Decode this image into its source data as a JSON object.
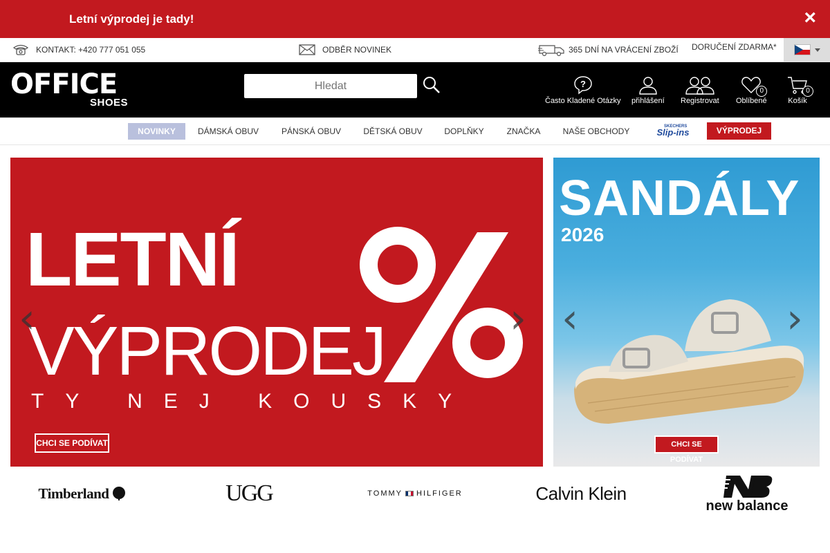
{
  "promo": {
    "text": " Letní výprodej je tady! ",
    "close": "×"
  },
  "infobar": {
    "contact": "KONTAKT: +420 777 051 055",
    "newsletter": "ODBĚR NOVINEK",
    "returns": "365 DNÍ NA VRÁCENÍ ZBOŽÍ",
    "delivery": "DORUČENÍ ZDARMA*",
    "language": "cz"
  },
  "header": {
    "logo_main": "OFFICE",
    "logo_sub": "SHOES",
    "search_placeholder": "Hledat",
    "faq_label": "Často Kladené Otázky",
    "login_label": "přihlášení",
    "register_label": "Registrovat",
    "favorites_label": "Oblíbené",
    "favorites_count": "0",
    "cart_label": "Košík",
    "cart_count": "0"
  },
  "nav": {
    "items": [
      {
        "label": "NOVINKY"
      },
      {
        "label": "DÁMSKÁ OBUV"
      },
      {
        "label": "PÁNSKÁ OBUV"
      },
      {
        "label": "DĚTSKÁ OBUV"
      },
      {
        "label": "DOPLŇKY"
      },
      {
        "label": "ZNAČKA"
      },
      {
        "label": "NAŠE OBCHODY"
      },
      {
        "label": "VÝPRODEJ"
      }
    ],
    "slipins_top": "SKECHERS",
    "slipins_label": "Slip-ins"
  },
  "banner_main": {
    "line1": "LETNÍ",
    "line2": "VÝPRODEJ",
    "tagline": "TY NEJ KOUSKY",
    "cta": "CHCI SE PODÍVAT",
    "prev": "‹",
    "next": "›"
  },
  "banner_side": {
    "title": "SANDÁLY",
    "year": "2026",
    "cta": "CHCI SE PODÍVAT",
    "prev": "‹",
    "next": "›"
  },
  "brands": {
    "timberland": "Timberland",
    "ugg": "UGG",
    "tommy": "TOMMY",
    "tommy2": "HILFIGER",
    "calvinklein": "Calvin Klein",
    "newbalance": "new balance"
  },
  "colors": {
    "brand_red": "#c2191f",
    "header_black": "#000000",
    "nav_active": "#b9c0dd"
  }
}
